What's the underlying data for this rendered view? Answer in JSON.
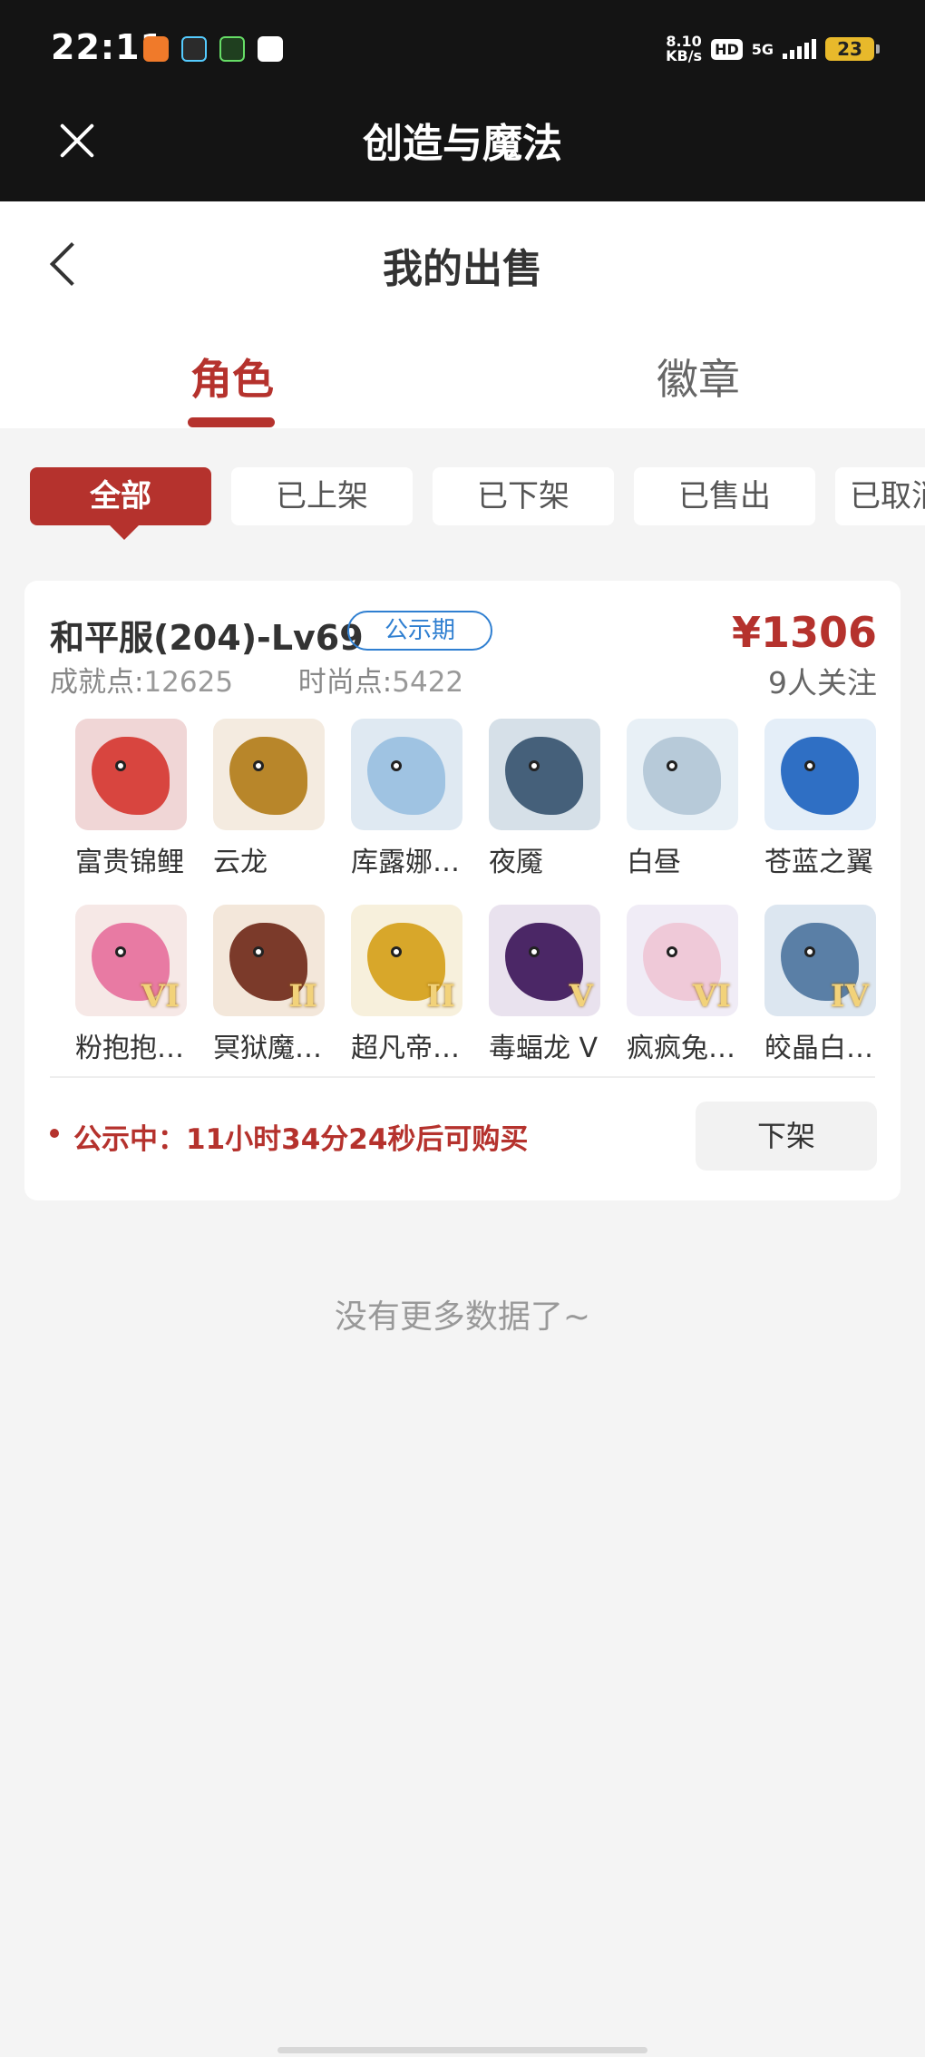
{
  "status_bar": {
    "time": "22:11",
    "speed_value": "8.10",
    "speed_unit": "KB/s",
    "hd": "HD",
    "network": "5G",
    "battery": "23"
  },
  "titlebar": {
    "title": "创造与魔法"
  },
  "header": {
    "title": "我的出售"
  },
  "tabs": [
    {
      "label": "角色",
      "active": true
    },
    {
      "label": "徽章",
      "active": false
    }
  ],
  "filters": [
    {
      "label": "全部",
      "active": true
    },
    {
      "label": "已上架",
      "active": false
    },
    {
      "label": "已下架",
      "active": false
    },
    {
      "label": "已售出",
      "active": false
    },
    {
      "label": "已取消",
      "active": false
    }
  ],
  "listing": {
    "account": "和平服(204)-Lv69",
    "badge": "公示期",
    "price": "¥1306",
    "achievement_label": "成就点:",
    "achievement_value": "12625",
    "fashion_label": "时尚点:",
    "fashion_value": "5422",
    "followers": "9人关注",
    "pets": [
      {
        "name": "富贵锦鲤",
        "rank": "",
        "bg": "#f0d6d6",
        "color": "#d8453f"
      },
      {
        "name": "云龙",
        "rank": "",
        "bg": "#f4ebe0",
        "color": "#b8862a"
      },
      {
        "name": "库露娜…",
        "rank": "",
        "bg": "#dfe9f2",
        "color": "#9fc3e2"
      },
      {
        "name": "夜魇",
        "rank": "",
        "bg": "#d6e0e8",
        "color": "#45607a"
      },
      {
        "name": "白昼",
        "rank": "",
        "bg": "#e8f0f6",
        "color": "#b7cad9"
      },
      {
        "name": "苍蓝之翼",
        "rank": "",
        "bg": "#e4eef8",
        "color": "#2f6fc4"
      },
      {
        "name": "粉抱抱…",
        "rank": "VI",
        "bg": "#f6e8e6",
        "color": "#e87aa3"
      },
      {
        "name": "冥狱魔…",
        "rank": "II",
        "bg": "#f3e7da",
        "color": "#7b3a2a"
      },
      {
        "name": "超凡帝…",
        "rank": "II",
        "bg": "#f7f0dc",
        "color": "#d8a72a"
      },
      {
        "name": "毒蝠龙 V",
        "rank": "V",
        "bg": "#e9e2ee",
        "color": "#4b2766"
      },
      {
        "name": "疯疯兔…",
        "rank": "VI",
        "bg": "#f0ecf6",
        "color": "#efc9d8"
      },
      {
        "name": "皎晶白…",
        "rank": "IV",
        "bg": "#dce6f0",
        "color": "#5a7fa6"
      }
    ],
    "notice": "公示中：11小时34分24秒后可购买",
    "delist_label": "下架"
  },
  "footer": {
    "no_more": "没有更多数据了~"
  },
  "colors": {
    "accent": "#b5322d",
    "badge_blue": "#2f7fd1"
  }
}
